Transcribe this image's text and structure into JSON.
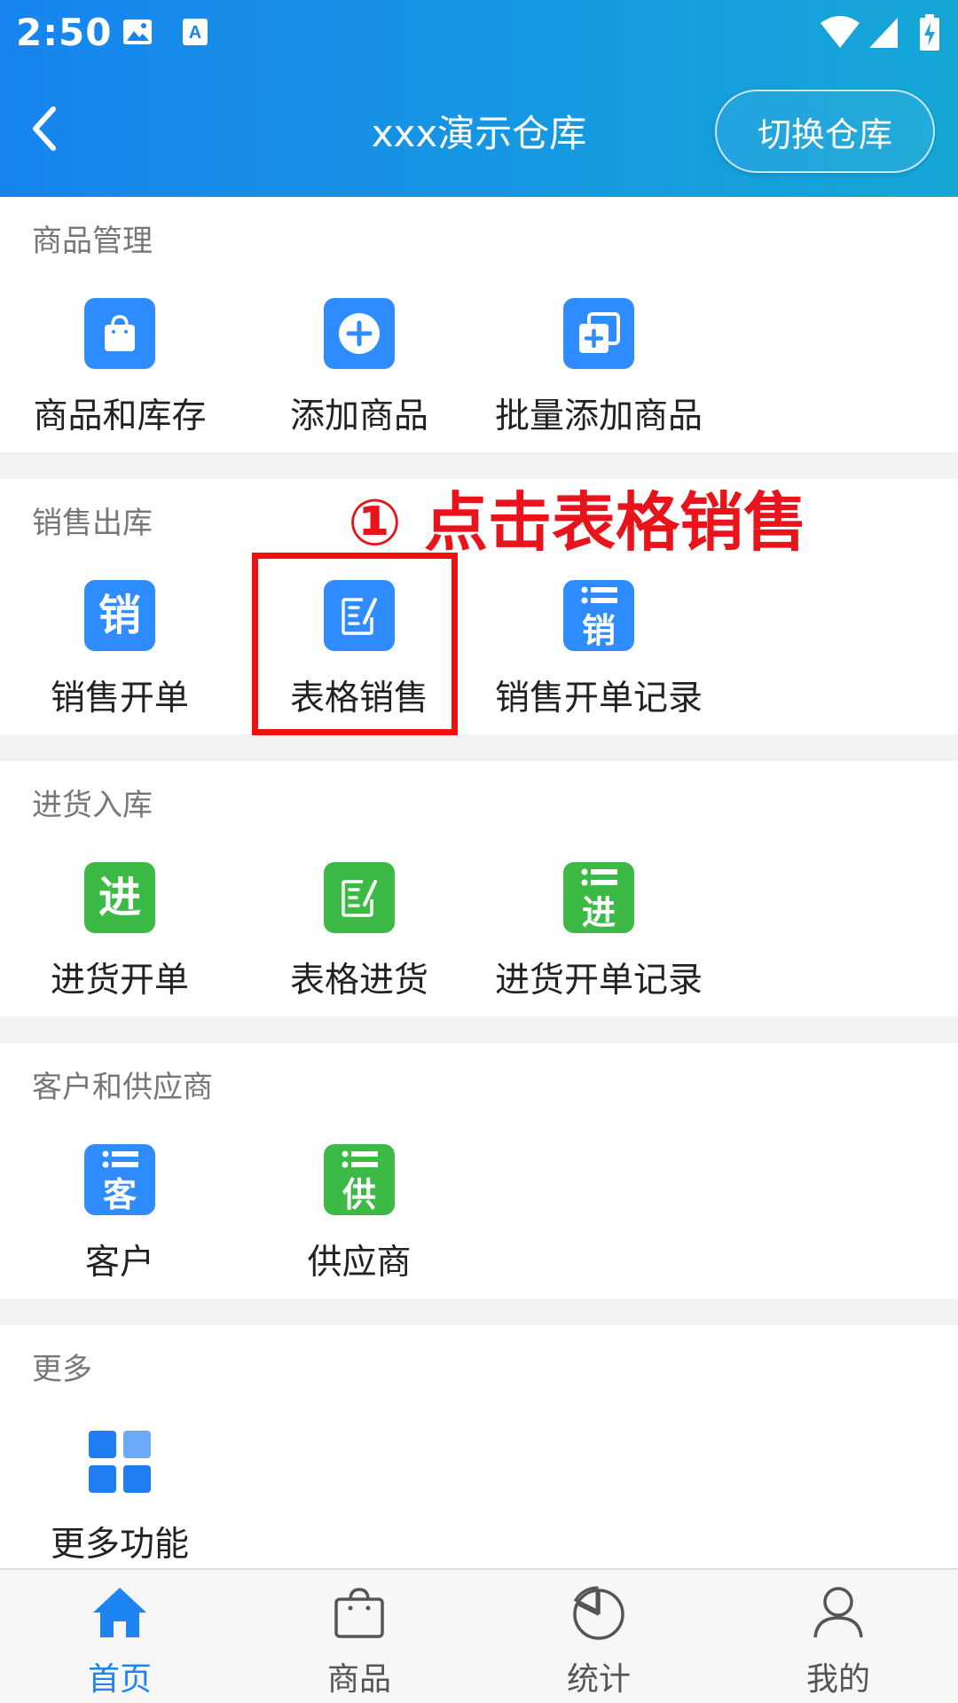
{
  "status_bar": {
    "time": "2:50"
  },
  "header": {
    "title": "xxx演示仓库",
    "switch_button": "切换仓库"
  },
  "annotation": {
    "text": "① 点击表格销售"
  },
  "sections": {
    "goods": {
      "title": "商品管理",
      "items": [
        {
          "label": "商品和库存",
          "icon": "shopping-bag-icon"
        },
        {
          "label": "添加商品",
          "icon": "plus-circle-icon"
        },
        {
          "label": "批量添加商品",
          "icon": "batch-add-icon"
        }
      ]
    },
    "sales": {
      "title": "销售出库",
      "items": [
        {
          "label": "销售开单",
          "icon": "sales-order-icon",
          "glyph": "销"
        },
        {
          "label": "表格销售",
          "icon": "edit-form-icon"
        },
        {
          "label": "销售开单记录",
          "icon": "sales-record-icon",
          "glyph": "销"
        }
      ]
    },
    "purchase": {
      "title": "进货入库",
      "items": [
        {
          "label": "进货开单",
          "icon": "purchase-order-icon",
          "glyph": "进"
        },
        {
          "label": "表格进货",
          "icon": "edit-form-icon"
        },
        {
          "label": "进货开单记录",
          "icon": "purchase-record-icon",
          "glyph": "进"
        }
      ]
    },
    "partners": {
      "title": "客户和供应商",
      "items": [
        {
          "label": "客户",
          "icon": "customer-list-icon",
          "glyph": "客"
        },
        {
          "label": "供应商",
          "icon": "supplier-list-icon",
          "glyph": "供"
        }
      ]
    },
    "more": {
      "title": "更多",
      "items": [
        {
          "label": "更多功能",
          "icon": "grid-icon"
        }
      ]
    }
  },
  "bottom_nav": [
    {
      "label": "首页",
      "icon": "home-icon",
      "active": true
    },
    {
      "label": "商品",
      "icon": "bag-icon",
      "active": false
    },
    {
      "label": "统计",
      "icon": "pie-chart-icon",
      "active": false
    },
    {
      "label": "我的",
      "icon": "user-icon",
      "active": false
    }
  ],
  "colors": {
    "header_start": "#1784ee",
    "header_end": "#16a7d6",
    "blue_tile": "#2f8cff",
    "green_tile": "#3dba45",
    "annotation": "#e8131b",
    "nav_active": "#1e84f0"
  }
}
